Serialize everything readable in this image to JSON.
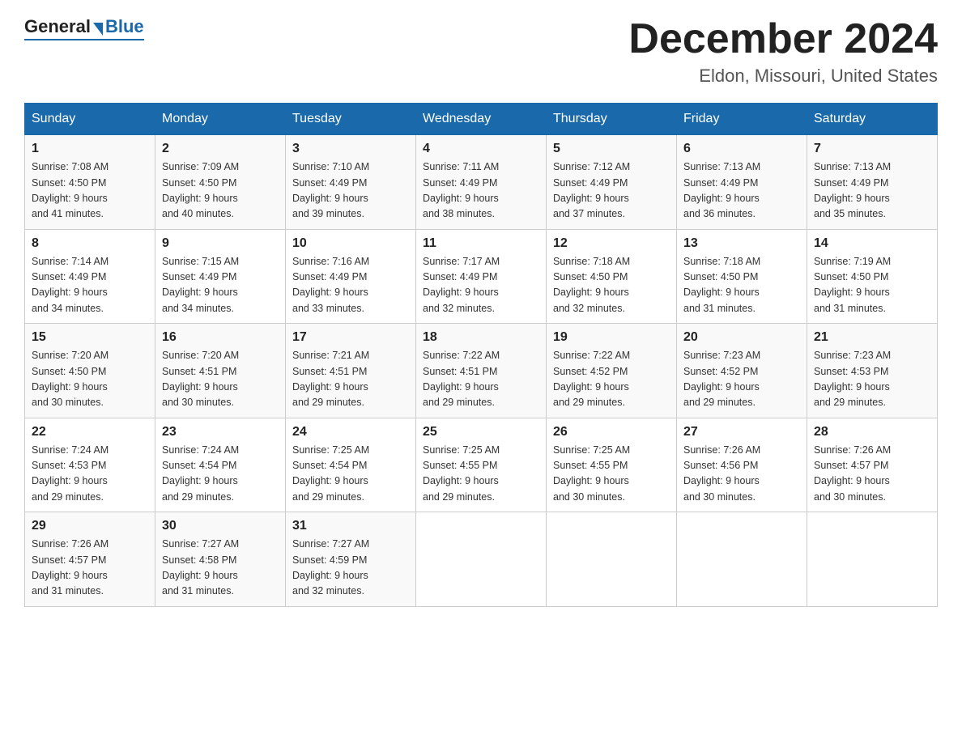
{
  "logo": {
    "general": "General",
    "blue": "Blue"
  },
  "title": "December 2024",
  "subtitle": "Eldon, Missouri, United States",
  "days_header": [
    "Sunday",
    "Monday",
    "Tuesday",
    "Wednesday",
    "Thursday",
    "Friday",
    "Saturday"
  ],
  "weeks": [
    [
      {
        "day": "1",
        "sunrise": "7:08 AM",
        "sunset": "4:50 PM",
        "daylight": "9 hours and 41 minutes."
      },
      {
        "day": "2",
        "sunrise": "7:09 AM",
        "sunset": "4:50 PM",
        "daylight": "9 hours and 40 minutes."
      },
      {
        "day": "3",
        "sunrise": "7:10 AM",
        "sunset": "4:49 PM",
        "daylight": "9 hours and 39 minutes."
      },
      {
        "day": "4",
        "sunrise": "7:11 AM",
        "sunset": "4:49 PM",
        "daylight": "9 hours and 38 minutes."
      },
      {
        "day": "5",
        "sunrise": "7:12 AM",
        "sunset": "4:49 PM",
        "daylight": "9 hours and 37 minutes."
      },
      {
        "day": "6",
        "sunrise": "7:13 AM",
        "sunset": "4:49 PM",
        "daylight": "9 hours and 36 minutes."
      },
      {
        "day": "7",
        "sunrise": "7:13 AM",
        "sunset": "4:49 PM",
        "daylight": "9 hours and 35 minutes."
      }
    ],
    [
      {
        "day": "8",
        "sunrise": "7:14 AM",
        "sunset": "4:49 PM",
        "daylight": "9 hours and 34 minutes."
      },
      {
        "day": "9",
        "sunrise": "7:15 AM",
        "sunset": "4:49 PM",
        "daylight": "9 hours and 34 minutes."
      },
      {
        "day": "10",
        "sunrise": "7:16 AM",
        "sunset": "4:49 PM",
        "daylight": "9 hours and 33 minutes."
      },
      {
        "day": "11",
        "sunrise": "7:17 AM",
        "sunset": "4:49 PM",
        "daylight": "9 hours and 32 minutes."
      },
      {
        "day": "12",
        "sunrise": "7:18 AM",
        "sunset": "4:50 PM",
        "daylight": "9 hours and 32 minutes."
      },
      {
        "day": "13",
        "sunrise": "7:18 AM",
        "sunset": "4:50 PM",
        "daylight": "9 hours and 31 minutes."
      },
      {
        "day": "14",
        "sunrise": "7:19 AM",
        "sunset": "4:50 PM",
        "daylight": "9 hours and 31 minutes."
      }
    ],
    [
      {
        "day": "15",
        "sunrise": "7:20 AM",
        "sunset": "4:50 PM",
        "daylight": "9 hours and 30 minutes."
      },
      {
        "day": "16",
        "sunrise": "7:20 AM",
        "sunset": "4:51 PM",
        "daylight": "9 hours and 30 minutes."
      },
      {
        "day": "17",
        "sunrise": "7:21 AM",
        "sunset": "4:51 PM",
        "daylight": "9 hours and 29 minutes."
      },
      {
        "day": "18",
        "sunrise": "7:22 AM",
        "sunset": "4:51 PM",
        "daylight": "9 hours and 29 minutes."
      },
      {
        "day": "19",
        "sunrise": "7:22 AM",
        "sunset": "4:52 PM",
        "daylight": "9 hours and 29 minutes."
      },
      {
        "day": "20",
        "sunrise": "7:23 AM",
        "sunset": "4:52 PM",
        "daylight": "9 hours and 29 minutes."
      },
      {
        "day": "21",
        "sunrise": "7:23 AM",
        "sunset": "4:53 PM",
        "daylight": "9 hours and 29 minutes."
      }
    ],
    [
      {
        "day": "22",
        "sunrise": "7:24 AM",
        "sunset": "4:53 PM",
        "daylight": "9 hours and 29 minutes."
      },
      {
        "day": "23",
        "sunrise": "7:24 AM",
        "sunset": "4:54 PM",
        "daylight": "9 hours and 29 minutes."
      },
      {
        "day": "24",
        "sunrise": "7:25 AM",
        "sunset": "4:54 PM",
        "daylight": "9 hours and 29 minutes."
      },
      {
        "day": "25",
        "sunrise": "7:25 AM",
        "sunset": "4:55 PM",
        "daylight": "9 hours and 29 minutes."
      },
      {
        "day": "26",
        "sunrise": "7:25 AM",
        "sunset": "4:55 PM",
        "daylight": "9 hours and 30 minutes."
      },
      {
        "day": "27",
        "sunrise": "7:26 AM",
        "sunset": "4:56 PM",
        "daylight": "9 hours and 30 minutes."
      },
      {
        "day": "28",
        "sunrise": "7:26 AM",
        "sunset": "4:57 PM",
        "daylight": "9 hours and 30 minutes."
      }
    ],
    [
      {
        "day": "29",
        "sunrise": "7:26 AM",
        "sunset": "4:57 PM",
        "daylight": "9 hours and 31 minutes."
      },
      {
        "day": "30",
        "sunrise": "7:27 AM",
        "sunset": "4:58 PM",
        "daylight": "9 hours and 31 minutes."
      },
      {
        "day": "31",
        "sunrise": "7:27 AM",
        "sunset": "4:59 PM",
        "daylight": "9 hours and 32 minutes."
      },
      null,
      null,
      null,
      null
    ]
  ],
  "labels": {
    "sunrise": "Sunrise:",
    "sunset": "Sunset:",
    "daylight": "Daylight:"
  }
}
